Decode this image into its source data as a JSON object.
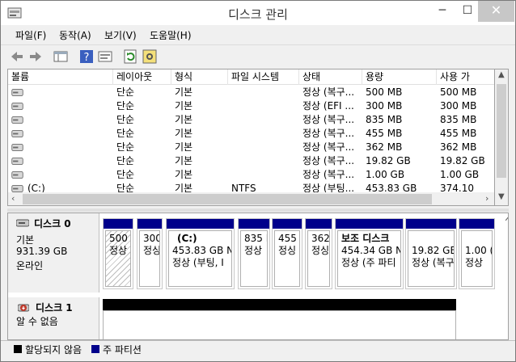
{
  "window": {
    "title": "디스크 관리",
    "min": "─",
    "max": "☐",
    "close": "✕"
  },
  "menu": [
    "파일(F)",
    "동작(A)",
    "보기(V)",
    "도움말(H)"
  ],
  "columns": [
    "볼륨",
    "레이아웃",
    "형식",
    "파일 시스템",
    "상태",
    "용량",
    "사용 가"
  ],
  "volumes": [
    {
      "name": "",
      "layout": "단순",
      "type": "기본",
      "fs": "",
      "status": "정상 (복구...",
      "capacity": "500 MB",
      "free": "500 MB"
    },
    {
      "name": "",
      "layout": "단순",
      "type": "기본",
      "fs": "",
      "status": "정상 (EFI ...",
      "capacity": "300 MB",
      "free": "300 MB"
    },
    {
      "name": "",
      "layout": "단순",
      "type": "기본",
      "fs": "",
      "status": "정상 (복구...",
      "capacity": "835 MB",
      "free": "835 MB"
    },
    {
      "name": "",
      "layout": "단순",
      "type": "기본",
      "fs": "",
      "status": "정상 (복구...",
      "capacity": "455 MB",
      "free": "455 MB"
    },
    {
      "name": "",
      "layout": "단순",
      "type": "기본",
      "fs": "",
      "status": "정상 (복구...",
      "capacity": "362 MB",
      "free": "362 MB"
    },
    {
      "name": "",
      "layout": "단순",
      "type": "기본",
      "fs": "",
      "status": "정상 (복구...",
      "capacity": "19.82 GB",
      "free": "19.82 GB"
    },
    {
      "name": "",
      "layout": "단순",
      "type": "기본",
      "fs": "",
      "status": "정상 (복구...",
      "capacity": "1.00 GB",
      "free": "1.00 GB"
    },
    {
      "name": "(C:)",
      "layout": "단순",
      "type": "기본",
      "fs": "NTFS",
      "status": "정상 (부팅...",
      "capacity": "453.83 GB",
      "free": "374.10"
    }
  ],
  "disk0": {
    "title": "디스크 0",
    "kind": "기본",
    "size": "931.39 GB",
    "state": "온라인",
    "partitions": [
      {
        "t1": "500",
        "t2": "정상"
      },
      {
        "t1": "300",
        "t2": "정싱"
      },
      {
        "t1": "(C:)",
        "t1b": "453.83 GB N",
        "t2": "정상 (부팅, I"
      },
      {
        "t1": "835 I",
        "t2": "정상"
      },
      {
        "t1": "455",
        "t2": "정싱"
      },
      {
        "t1": "362",
        "t2": "정싱"
      },
      {
        "t1": "보조 디스크",
        "t1b": "454.34 GB N",
        "t2": "정상 (주 파티"
      },
      {
        "t1": "19.82 GB",
        "t2": "정상 (복구"
      },
      {
        "t1": "1.00 (",
        "t2": "정상"
      }
    ]
  },
  "disk1": {
    "title": "디스크 1",
    "state": "알 수 없음"
  },
  "legend": [
    {
      "label": "할당되지 않음",
      "color": "#000000"
    },
    {
      "label": "주 파티션",
      "color": "#00008b"
    }
  ]
}
